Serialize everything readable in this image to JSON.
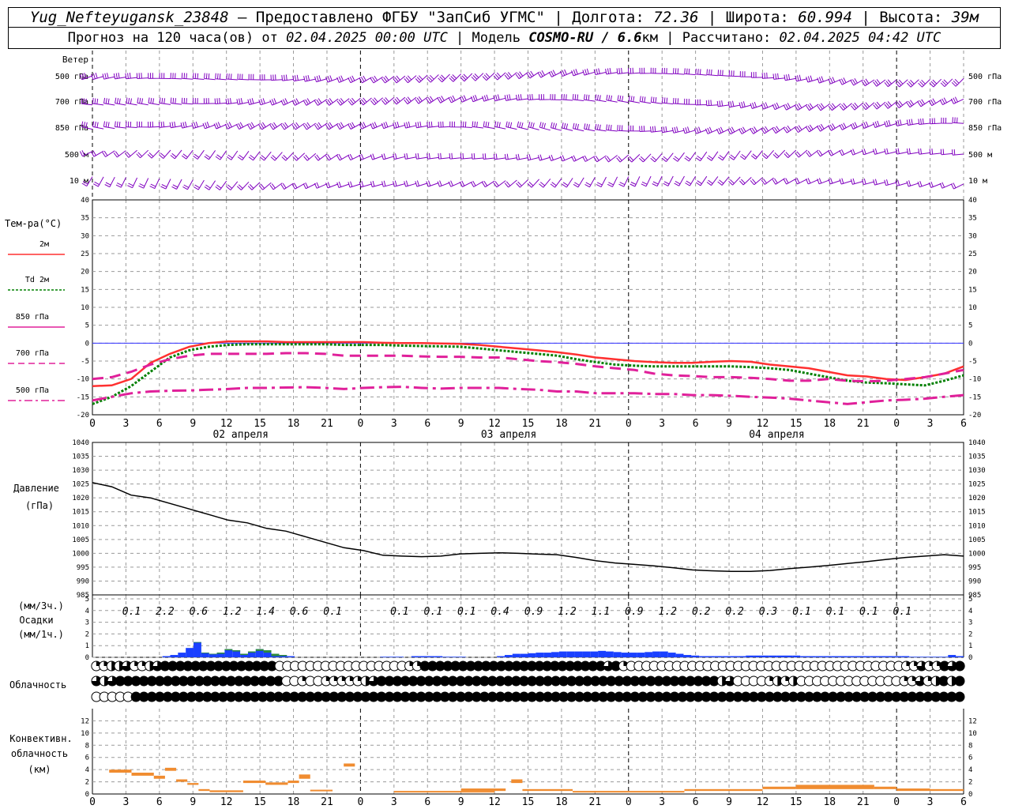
{
  "header": {
    "station": "Yug_Nefteyugansk_23848",
    "provided": "– Предоставлено ФГБУ \"ЗапСиб УГМС\"",
    "lon_label": "Долгота:",
    "lon": "72.36",
    "lat_label": "Широта:",
    "lat": "60.994",
    "alt_label": "Высота:",
    "alt": "39м",
    "forecast_prefix": "Прогноз на 120 часа(ов) от",
    "forecast_from": "02.04.2025 00:00 UTC",
    "model_label": "Модель",
    "model": "COSMO-RU / 6.6",
    "model_unit": "км",
    "calc_label": "Рассчитано:",
    "calc": "02.04.2025 04:42 UTC"
  },
  "labels": {
    "wind": "Ветер",
    "wind_levels": [
      "500 гПа",
      "700 гПа",
      "850 гПа",
      "500 м",
      "10 м"
    ],
    "temp_title": "Тем-ра(°C)",
    "temp_legend": [
      "2м",
      "Td 2м",
      "850 гПа",
      "700 гПа",
      "500 гПа"
    ],
    "dates": [
      "02 апреля",
      "03 апреля",
      "04 апреля"
    ],
    "pressure": [
      "Давление",
      "(гПа)"
    ],
    "precip": [
      "(мм/3ч.)",
      "Осадки",
      "(мм/1ч.)"
    ],
    "cloud": "Облачность",
    "conv": [
      "Конвективн.",
      "облачность",
      "(км)"
    ]
  },
  "colors": {
    "wind": "#8000c0",
    "t2m": "#ff3030",
    "td2m": "#008000",
    "t850": "#e0209a",
    "t700": "#e0209a",
    "t500": "#e0209a",
    "pressure": "#000000",
    "precip": "#1a40ff",
    "precip_conv": "#2e8b3a",
    "conv": "#f08c30",
    "zero_line": "#3030ff"
  },
  "chart_data": [
    {
      "type": "line",
      "name": "temperature",
      "ylim": [
        -20,
        40
      ],
      "x_hours_ticks": [
        "0",
        "3",
        "6",
        "9",
        "12",
        "15",
        "18",
        "21",
        "0",
        "3",
        "6",
        "9",
        "12",
        "15",
        "18",
        "21",
        "0",
        "3",
        "6",
        "9",
        "12",
        "15",
        "18",
        "21",
        "0",
        "3",
        "6"
      ],
      "x_hours": [
        0,
        3,
        6,
        9,
        12,
        15,
        18,
        21,
        24,
        27,
        30,
        33,
        36,
        39,
        42,
        45,
        48,
        51,
        54,
        57,
        60,
        63,
        66,
        69,
        72,
        75,
        78
      ],
      "series": [
        {
          "name": "2м",
          "values": [
            -12,
            -11.8,
            -10,
            -5.5,
            -3,
            -1,
            0,
            0.5,
            0.5,
            0.5,
            0.3,
            0.3,
            0.3,
            0.3,
            0.3,
            0.1,
            0,
            0,
            -0.1,
            -0.2,
            -0.5,
            -1,
            -1.5,
            -2,
            -2.5,
            -3.2,
            -4,
            -4.5,
            -5,
            -5.3,
            -5.5,
            -5.5,
            -5.2,
            -5,
            -5.2,
            -6,
            -6.5,
            -7,
            -8,
            -9,
            -9.3,
            -10,
            -10.3,
            -9.5,
            -8.5,
            -6.5
          ]
        },
        {
          "name": "Td 2м",
          "values": [
            -17,
            -15,
            -12,
            -8,
            -4,
            -2,
            -1,
            -0.5,
            -0.3,
            -0.3,
            -0.3,
            -0.3,
            -0.3,
            -0.5,
            -0.5,
            -0.5,
            -0.7,
            -0.8,
            -0.9,
            -1,
            -1.5,
            -2,
            -2.5,
            -3,
            -3.5,
            -4.5,
            -5.3,
            -6,
            -6.3,
            -6.5,
            -6.5,
            -6.5,
            -6.5,
            -6.5,
            -6.7,
            -7,
            -7.5,
            -8.5,
            -9.5,
            -10.5,
            -11,
            -11.2,
            -11.5,
            -11.8,
            -10.5,
            -9
          ]
        },
        {
          "name": "850 гПа",
          "values": [
            -10,
            -9.5,
            -8,
            -6,
            -4.5,
            -3.5,
            -3,
            -3,
            -3,
            -3,
            -2.8,
            -2.8,
            -3,
            -3.5,
            -3.5,
            -3.5,
            -3.5,
            -3.7,
            -3.8,
            -3.8,
            -4,
            -4,
            -4.5,
            -5,
            -5.3,
            -5.8,
            -6.5,
            -7,
            -7.5,
            -8.5,
            -9,
            -9.2,
            -9.5,
            -9.5,
            -9.7,
            -10,
            -10.5,
            -10.5,
            -10,
            -10.5,
            -10.7,
            -10.5,
            -10,
            -9.5,
            -8.5,
            -7.5
          ]
        },
        {
          "name": "700 гПа",
          "values": [
            -16,
            -15,
            -14,
            -13.5,
            -13.3,
            -13.2,
            -13,
            -12.8,
            -12.5,
            -12.5,
            -12.4,
            -12.3,
            -12.5,
            -12.8,
            -12.5,
            -12.3,
            -12.2,
            -12.5,
            -12.7,
            -12.5,
            -12.5,
            -12.5,
            -12.8,
            -13,
            -13.5,
            -13.5,
            -14,
            -14,
            -14,
            -14.2,
            -14.2,
            -14.5,
            -14.5,
            -14.7,
            -15,
            -15.2,
            -15.5,
            -16,
            -16.5,
            -17,
            -16.5,
            -16,
            -15.8,
            -15.5,
            -15,
            -14.5
          ]
        }
      ]
    },
    {
      "type": "line",
      "name": "pressure",
      "ylim": [
        985,
        1040
      ],
      "values": [
        1025.5,
        1024,
        1021,
        1020,
        1018,
        1016,
        1014,
        1012,
        1011,
        1009,
        1008,
        1006,
        1004,
        1002,
        1001,
        999.3,
        999,
        998.8,
        999,
        999.8,
        1000,
        1000.2,
        1000,
        999.7,
        999.5,
        998.5,
        997.3,
        996.5,
        996,
        995.5,
        994.8,
        994,
        993.7,
        993.5,
        993.5,
        993.8,
        994.5,
        995,
        995.6,
        996.3,
        997,
        997.8,
        998.5,
        999,
        999.5,
        999
      ]
    },
    {
      "type": "bar",
      "name": "precipitation",
      "ylim": [
        0,
        5
      ],
      "labels_3h": [
        "0.1",
        "2.2",
        "0.6",
        "1.2",
        "1.4",
        "0.6",
        "0.1",
        "",
        "0.1",
        "0.1",
        "0.1",
        "0.4",
        "0.9",
        "1.2",
        "1.1",
        "0.9",
        "1.2",
        "0.2",
        "0.2",
        "0.3",
        "0.1",
        "0.1",
        "0.1",
        "0.1"
      ],
      "values_1h": [
        0,
        0,
        0,
        0,
        0,
        0,
        0,
        0,
        0,
        0.1,
        0.2,
        0.4,
        0.8,
        1.3,
        0.4,
        0.3,
        0.4,
        0.7,
        0.6,
        0.3,
        0.5,
        0.7,
        0.6,
        0.3,
        0.2,
        0.1,
        0,
        0,
        0,
        0,
        0,
        0,
        0,
        0,
        0,
        0,
        0,
        0.05,
        0.05,
        0.05,
        0,
        0.1,
        0.1,
        0.1,
        0.1,
        0.05,
        0.05,
        0.05,
        0,
        0,
        0,
        0,
        0.1,
        0.2,
        0.3,
        0.3,
        0.35,
        0.4,
        0.4,
        0.45,
        0.5,
        0.5,
        0.5,
        0.5,
        0.5,
        0.55,
        0.5,
        0.45,
        0.4,
        0.4,
        0.4,
        0.45,
        0.5,
        0.5,
        0.4,
        0.3,
        0.2,
        0.15,
        0.1,
        0.1,
        0.1,
        0.1,
        0.1,
        0.1,
        0.15,
        0.15,
        0.15,
        0.15,
        0.15,
        0.15,
        0.15,
        0.1,
        0.1,
        0.1,
        0.1,
        0.1,
        0.1,
        0.1,
        0.1,
        0.1,
        0.1,
        0.1,
        0.1,
        0.1,
        0.1,
        0.05,
        0.05,
        0.05,
        0.05,
        0.05,
        0.2,
        0.1
      ],
      "conv_1h": [
        0,
        0,
        0,
        0,
        0,
        0,
        0,
        0,
        0,
        0,
        0,
        0,
        0,
        0.05,
        0.05,
        0.05,
        0.1,
        0.1,
        0.1,
        0.1,
        0.1,
        0.15,
        0.2,
        0.2,
        0.1,
        0,
        0,
        0,
        0,
        0,
        0,
        0,
        0,
        0,
        0,
        0,
        0,
        0,
        0,
        0,
        0,
        0,
        0,
        0,
        0,
        0,
        0,
        0,
        0,
        0,
        0,
        0,
        0,
        0,
        0,
        0,
        0,
        0,
        0,
        0,
        0,
        0,
        0,
        0,
        0,
        0,
        0,
        0,
        0,
        0,
        0,
        0,
        0,
        0,
        0,
        0,
        0,
        0,
        0,
        0,
        0,
        0,
        0,
        0,
        0,
        0,
        0,
        0,
        0,
        0,
        0,
        0,
        0,
        0,
        0,
        0,
        0,
        0,
        0,
        0,
        0,
        0,
        0,
        0,
        0,
        0,
        0,
        0,
        0,
        0
      ]
    },
    {
      "type": "table",
      "name": "cloudiness",
      "rows": [
        [
          1,
          1,
          2,
          2,
          3,
          1,
          1,
          2,
          3,
          4,
          4,
          4,
          4,
          4,
          4,
          4,
          4,
          4,
          4,
          4,
          4,
          4,
          4,
          4,
          0,
          0,
          0,
          0,
          0,
          0,
          0,
          0,
          0,
          0,
          0,
          0,
          0,
          0,
          0,
          0,
          0,
          1,
          1,
          4,
          4,
          4,
          4,
          4,
          4,
          4,
          4,
          4,
          4,
          4,
          4,
          4,
          4,
          4,
          4,
          4,
          4,
          4,
          4,
          4,
          4,
          4,
          4,
          3,
          4,
          1,
          0,
          0,
          0,
          0,
          0,
          0,
          0,
          0,
          0,
          0,
          0,
          0,
          0,
          0,
          0,
          0,
          0,
          0,
          0,
          0,
          0,
          0,
          0,
          0,
          0,
          0,
          0,
          0,
          0,
          0,
          0,
          0,
          0,
          0,
          0,
          0,
          1,
          1,
          3,
          1,
          1,
          4,
          3,
          4
        ],
        [
          3,
          2,
          3,
          4,
          4,
          4,
          4,
          4,
          4,
          4,
          4,
          4,
          4,
          4,
          4,
          4,
          4,
          4,
          4,
          4,
          4,
          4,
          4,
          4,
          0,
          0,
          1,
          0,
          0,
          1,
          1,
          1,
          1,
          1,
          2,
          3,
          4,
          4,
          4,
          4,
          4,
          4,
          4,
          4,
          4,
          4,
          4,
          4,
          4,
          4,
          4,
          4,
          4,
          4,
          4,
          4,
          4,
          4,
          4,
          4,
          4,
          4,
          4,
          4,
          4,
          4,
          4,
          4,
          4,
          4,
          4,
          4,
          4,
          4,
          4,
          4,
          4,
          4,
          4,
          2,
          3,
          0,
          0,
          0,
          0,
          1,
          2,
          1,
          2,
          0,
          0,
          0,
          0,
          0,
          0,
          0,
          0,
          0,
          0,
          0,
          0,
          0,
          1,
          1,
          3,
          1,
          2,
          4,
          2,
          4
        ],
        [
          0,
          0,
          0,
          0,
          0,
          4,
          4,
          4,
          4,
          4,
          4,
          4,
          4,
          4,
          4,
          4,
          4,
          4,
          4,
          4,
          4,
          4,
          4,
          4,
          4,
          4,
          4,
          4,
          4,
          4,
          4,
          4,
          4,
          4,
          4,
          4,
          4,
          4,
          4,
          4,
          4,
          4,
          4,
          4,
          4,
          4,
          4,
          4,
          4,
          4,
          4,
          4,
          4,
          4,
          4,
          4,
          4,
          4,
          4,
          4,
          4,
          4,
          4,
          4,
          4,
          4,
          4,
          4,
          4,
          4,
          4,
          4,
          4,
          4,
          4,
          4,
          4,
          4,
          4,
          4,
          4,
          4,
          4,
          4,
          4,
          4,
          4,
          4,
          4,
          4,
          4,
          4,
          4,
          4,
          4,
          4,
          4,
          4,
          4,
          4,
          4,
          4,
          4,
          4,
          4,
          4,
          4,
          4,
          4,
          4
        ]
      ]
    },
    {
      "type": "bar",
      "name": "convective_cloud",
      "ylim": [
        0,
        14
      ],
      "segments": [
        {
          "h0": 1.5,
          "h1": 3.5,
          "bot": 3.5,
          "top": 4.0
        },
        {
          "h0": 3.5,
          "h1": 5.5,
          "bot": 3.0,
          "top": 3.5
        },
        {
          "h0": 5.5,
          "h1": 6.5,
          "bot": 2.5,
          "top": 3.0
        },
        {
          "h0": 6.5,
          "h1": 7.5,
          "bot": 3.8,
          "top": 4.3
        },
        {
          "h0": 7.5,
          "h1": 8.5,
          "bot": 2.0,
          "top": 2.4
        },
        {
          "h0": 8.5,
          "h1": 9.5,
          "bot": 1.5,
          "top": 1.8
        },
        {
          "h0": 9.5,
          "h1": 10.5,
          "bot": 0.5,
          "top": 0.8
        },
        {
          "h0": 10.5,
          "h1": 13.5,
          "bot": 0.3,
          "top": 0.6
        },
        {
          "h0": 13.5,
          "h1": 15.5,
          "bot": 1.8,
          "top": 2.2
        },
        {
          "h0": 15.5,
          "h1": 17.5,
          "bot": 1.5,
          "top": 1.9
        },
        {
          "h0": 17.5,
          "h1": 18.5,
          "bot": 1.8,
          "top": 2.2
        },
        {
          "h0": 18.5,
          "h1": 19.5,
          "bot": 2.5,
          "top": 3.2
        },
        {
          "h0": 19.5,
          "h1": 21.5,
          "bot": 0.5,
          "top": 0.7
        },
        {
          "h0": 22.5,
          "h1": 23.5,
          "bot": 4.5,
          "top": 5.0
        },
        {
          "h0": 27,
          "h1": 36,
          "bot": 0.3,
          "top": 0.5
        },
        {
          "h0": 33,
          "h1": 37,
          "bot": 0.5,
          "top": 0.9
        },
        {
          "h0": 37.5,
          "h1": 38.5,
          "bot": 1.8,
          "top": 2.4
        },
        {
          "h0": 38.5,
          "h1": 43,
          "bot": 0.5,
          "top": 0.8
        },
        {
          "h0": 43,
          "h1": 53,
          "bot": 0.3,
          "top": 0.5
        },
        {
          "h0": 53,
          "h1": 60,
          "bot": 0.5,
          "top": 0.8
        },
        {
          "h0": 60,
          "h1": 63,
          "bot": 0.8,
          "top": 1.2
        },
        {
          "h0": 63,
          "h1": 70,
          "bot": 0.8,
          "top": 1.5
        },
        {
          "h0": 70,
          "h1": 72,
          "bot": 0.8,
          "top": 1.2
        },
        {
          "h0": 72,
          "h1": 75,
          "bot": 0.5,
          "top": 0.9
        },
        {
          "h0": 75,
          "h1": 78,
          "bot": 0.5,
          "top": 0.8
        }
      ]
    }
  ]
}
